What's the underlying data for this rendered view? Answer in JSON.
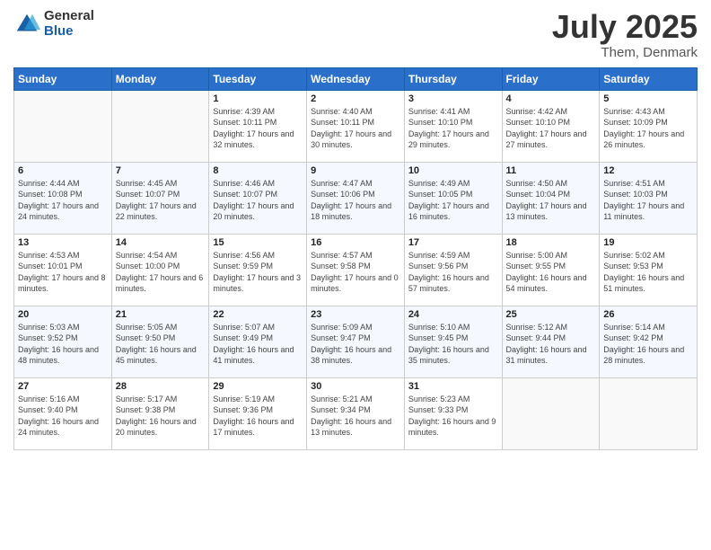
{
  "logo": {
    "general": "General",
    "blue": "Blue"
  },
  "title": "July 2025",
  "location": "Them, Denmark",
  "headers": [
    "Sunday",
    "Monday",
    "Tuesday",
    "Wednesday",
    "Thursday",
    "Friday",
    "Saturday"
  ],
  "weeks": [
    [
      {
        "day": "",
        "detail": ""
      },
      {
        "day": "",
        "detail": ""
      },
      {
        "day": "1",
        "detail": "Sunrise: 4:39 AM\nSunset: 10:11 PM\nDaylight: 17 hours\nand 32 minutes."
      },
      {
        "day": "2",
        "detail": "Sunrise: 4:40 AM\nSunset: 10:11 PM\nDaylight: 17 hours\nand 30 minutes."
      },
      {
        "day": "3",
        "detail": "Sunrise: 4:41 AM\nSunset: 10:10 PM\nDaylight: 17 hours\nand 29 minutes."
      },
      {
        "day": "4",
        "detail": "Sunrise: 4:42 AM\nSunset: 10:10 PM\nDaylight: 17 hours\nand 27 minutes."
      },
      {
        "day": "5",
        "detail": "Sunrise: 4:43 AM\nSunset: 10:09 PM\nDaylight: 17 hours\nand 26 minutes."
      }
    ],
    [
      {
        "day": "6",
        "detail": "Sunrise: 4:44 AM\nSunset: 10:08 PM\nDaylight: 17 hours\nand 24 minutes."
      },
      {
        "day": "7",
        "detail": "Sunrise: 4:45 AM\nSunset: 10:07 PM\nDaylight: 17 hours\nand 22 minutes."
      },
      {
        "day": "8",
        "detail": "Sunrise: 4:46 AM\nSunset: 10:07 PM\nDaylight: 17 hours\nand 20 minutes."
      },
      {
        "day": "9",
        "detail": "Sunrise: 4:47 AM\nSunset: 10:06 PM\nDaylight: 17 hours\nand 18 minutes."
      },
      {
        "day": "10",
        "detail": "Sunrise: 4:49 AM\nSunset: 10:05 PM\nDaylight: 17 hours\nand 16 minutes."
      },
      {
        "day": "11",
        "detail": "Sunrise: 4:50 AM\nSunset: 10:04 PM\nDaylight: 17 hours\nand 13 minutes."
      },
      {
        "day": "12",
        "detail": "Sunrise: 4:51 AM\nSunset: 10:03 PM\nDaylight: 17 hours\nand 11 minutes."
      }
    ],
    [
      {
        "day": "13",
        "detail": "Sunrise: 4:53 AM\nSunset: 10:01 PM\nDaylight: 17 hours\nand 8 minutes."
      },
      {
        "day": "14",
        "detail": "Sunrise: 4:54 AM\nSunset: 10:00 PM\nDaylight: 17 hours\nand 6 minutes."
      },
      {
        "day": "15",
        "detail": "Sunrise: 4:56 AM\nSunset: 9:59 PM\nDaylight: 17 hours\nand 3 minutes."
      },
      {
        "day": "16",
        "detail": "Sunrise: 4:57 AM\nSunset: 9:58 PM\nDaylight: 17 hours\nand 0 minutes."
      },
      {
        "day": "17",
        "detail": "Sunrise: 4:59 AM\nSunset: 9:56 PM\nDaylight: 16 hours\nand 57 minutes."
      },
      {
        "day": "18",
        "detail": "Sunrise: 5:00 AM\nSunset: 9:55 PM\nDaylight: 16 hours\nand 54 minutes."
      },
      {
        "day": "19",
        "detail": "Sunrise: 5:02 AM\nSunset: 9:53 PM\nDaylight: 16 hours\nand 51 minutes."
      }
    ],
    [
      {
        "day": "20",
        "detail": "Sunrise: 5:03 AM\nSunset: 9:52 PM\nDaylight: 16 hours\nand 48 minutes."
      },
      {
        "day": "21",
        "detail": "Sunrise: 5:05 AM\nSunset: 9:50 PM\nDaylight: 16 hours\nand 45 minutes."
      },
      {
        "day": "22",
        "detail": "Sunrise: 5:07 AM\nSunset: 9:49 PM\nDaylight: 16 hours\nand 41 minutes."
      },
      {
        "day": "23",
        "detail": "Sunrise: 5:09 AM\nSunset: 9:47 PM\nDaylight: 16 hours\nand 38 minutes."
      },
      {
        "day": "24",
        "detail": "Sunrise: 5:10 AM\nSunset: 9:45 PM\nDaylight: 16 hours\nand 35 minutes."
      },
      {
        "day": "25",
        "detail": "Sunrise: 5:12 AM\nSunset: 9:44 PM\nDaylight: 16 hours\nand 31 minutes."
      },
      {
        "day": "26",
        "detail": "Sunrise: 5:14 AM\nSunset: 9:42 PM\nDaylight: 16 hours\nand 28 minutes."
      }
    ],
    [
      {
        "day": "27",
        "detail": "Sunrise: 5:16 AM\nSunset: 9:40 PM\nDaylight: 16 hours\nand 24 minutes."
      },
      {
        "day": "28",
        "detail": "Sunrise: 5:17 AM\nSunset: 9:38 PM\nDaylight: 16 hours\nand 20 minutes."
      },
      {
        "day": "29",
        "detail": "Sunrise: 5:19 AM\nSunset: 9:36 PM\nDaylight: 16 hours\nand 17 minutes."
      },
      {
        "day": "30",
        "detail": "Sunrise: 5:21 AM\nSunset: 9:34 PM\nDaylight: 16 hours\nand 13 minutes."
      },
      {
        "day": "31",
        "detail": "Sunrise: 5:23 AM\nSunset: 9:33 PM\nDaylight: 16 hours\nand 9 minutes."
      },
      {
        "day": "",
        "detail": ""
      },
      {
        "day": "",
        "detail": ""
      }
    ]
  ]
}
